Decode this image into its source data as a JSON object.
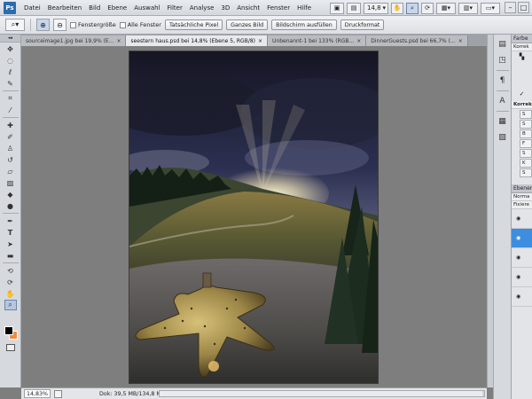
{
  "app": {
    "logo": "Ps",
    "menu": [
      "Datei",
      "Bearbeiten",
      "Bild",
      "Ebene",
      "Auswahl",
      "Filter",
      "Analyse",
      "3D",
      "Ansicht",
      "Fenster",
      "Hilfe"
    ],
    "zoom_display": "14,8"
  },
  "options_bar": {
    "fit_window_label": "Fenstergröße",
    "all_windows_label": "Alle Fenster",
    "buttons": [
      "Tatsächliche Pixel",
      "Ganzes Bild",
      "Bildschirm ausfüllen",
      "Druckformat"
    ]
  },
  "tabs": [
    {
      "label": "sourceimage1.jpg bei 19,9% (E...",
      "active": false
    },
    {
      "label": "seestern haus.psd bei 14,8% (Ebene 5, RGB/8)",
      "active": true
    },
    {
      "label": "Unbenannt-1 bei 133% (RGB...",
      "active": false
    },
    {
      "label": "DinnerGuests.psd bei 66,7% (...",
      "active": false
    }
  ],
  "status_bar": {
    "zoom": "14,83%",
    "doc_info": "Dok: 39,5 MB/134,8 MB"
  },
  "right_panels": {
    "adjustments_tab": "Farbe",
    "adjustments_sub": "Korrek",
    "adjustments_bold": "Korrek",
    "adjustment_items": [
      "S",
      "S",
      "B",
      "F",
      "S",
      "K",
      "S"
    ],
    "layers_tab": "Ebenen",
    "blend_mode": "Norma",
    "lock_label": "Fixiere"
  },
  "colors": {
    "foreground": "#000000",
    "background": "#f08c3c",
    "selected_layer": "#3d8ee0"
  },
  "tools": [
    "move",
    "marquee",
    "lasso",
    "quick-select",
    "crop",
    "eyedropper",
    "spot-heal",
    "brush",
    "clone-stamp",
    "history-brush",
    "eraser",
    "gradient",
    "blur",
    "dodge",
    "pen",
    "type",
    "path-select",
    "shape",
    "3d-rotate",
    "3d-orbit",
    "hand",
    "zoom"
  ]
}
